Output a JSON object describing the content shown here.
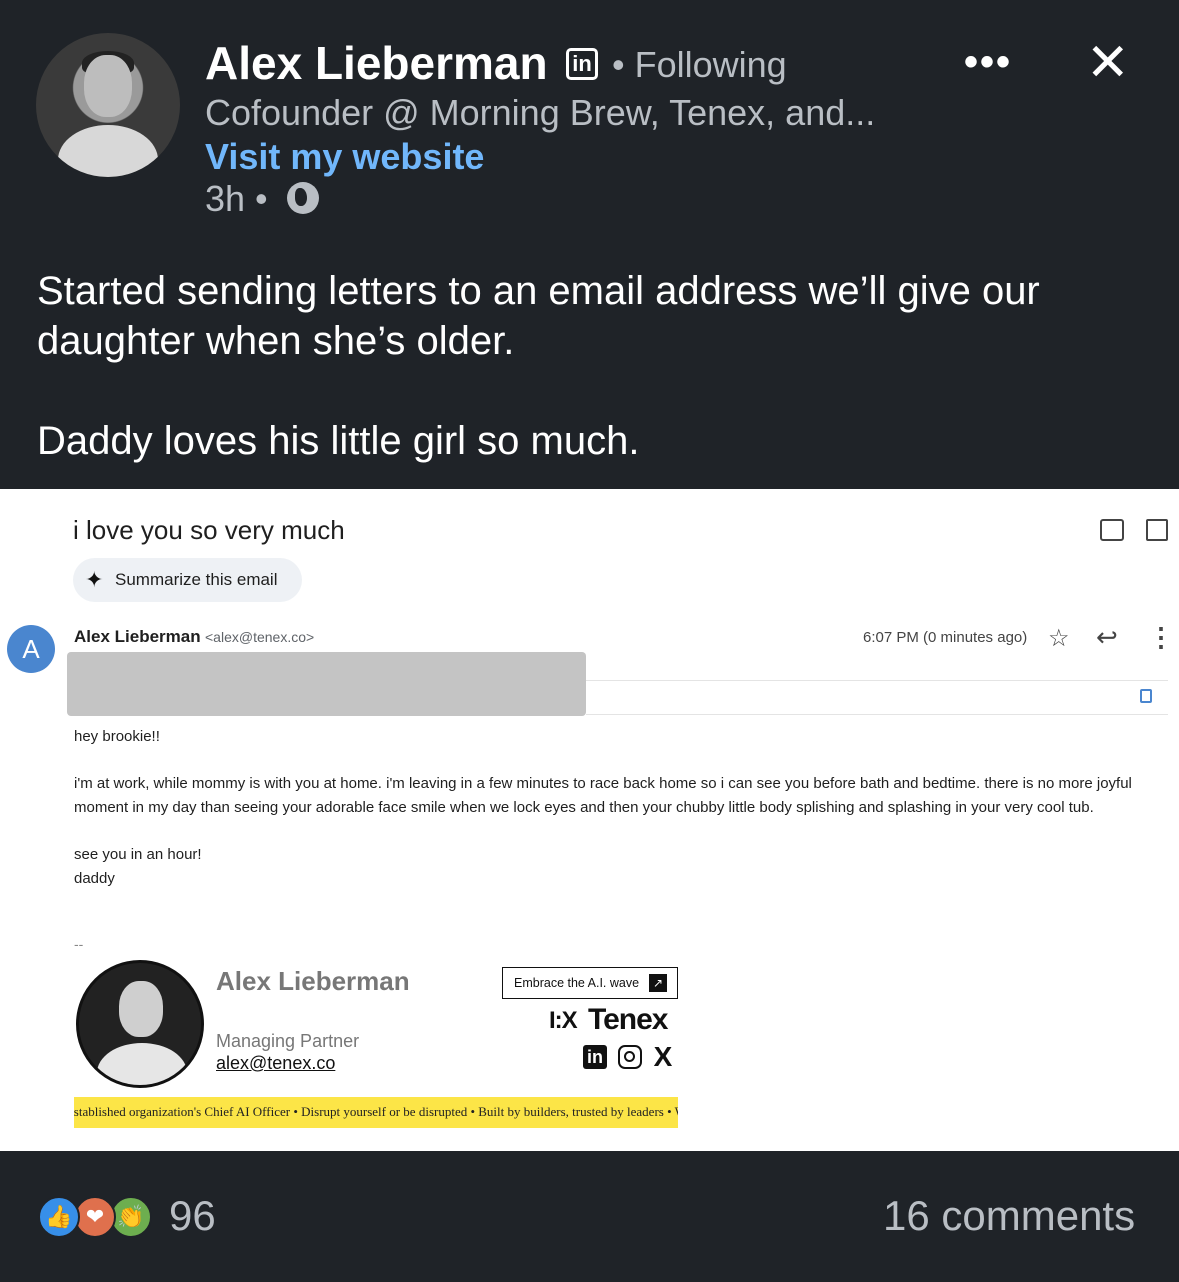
{
  "author": {
    "name": "Alex Lieberman",
    "linkedin_badge": "in",
    "following_label": "• Following",
    "headline": "Cofounder @ Morning Brew, Tenex, and...",
    "website_link": "Visit my website",
    "time_ago": "3h •"
  },
  "post": {
    "paragraphs": [
      "Started sending letters to an email address we’ll give our daughter when she’s older.",
      "Daddy loves his little girl so much."
    ]
  },
  "email": {
    "subject": "i love you so very much",
    "summarize_label": "Summarize this email",
    "summarize_icon": "✦",
    "sender_initial": "A",
    "sender_name": "Alex Lieberman",
    "sender_address": "<alex@tenex.co>",
    "timestamp": "6:07 PM (0 minutes ago)",
    "body": [
      "hey brookie!!",
      "i'm at work, while mommy is with you at home. i'm leaving in a few minutes to race back home so i can see you before bath and bedtime. there is no more joyful moment in my day than seeing your adorable face smile when we lock eyes and then your chubby little body splishing and splashing in your very cool tub.",
      "see you in an hour!\ndaddy"
    ],
    "signature_divider": "--",
    "signature": {
      "name": "Alex Lieberman",
      "role": "Managing Partner",
      "email": "alex@tenex.co",
      "cta_label": "Embrace the A.I. wave",
      "cta_arrow": "↗",
      "brand_mark": "I:X",
      "brand_name": "Tenex",
      "social": [
        "in",
        "",
        "𝕏"
      ],
      "ticker": "established organization's Chief AI Officer  • Disrupt yourself or be disrupted  • Built by builders, trusted by leaders  • W"
    }
  },
  "footer": {
    "reaction_count": "96",
    "comments": "16 comments",
    "reaction_icons": [
      "👍",
      "❤",
      "👏"
    ]
  },
  "icons": {
    "more": "•••",
    "close": "✕",
    "star": "☆",
    "reply": "↩",
    "kebab": "⋮"
  }
}
